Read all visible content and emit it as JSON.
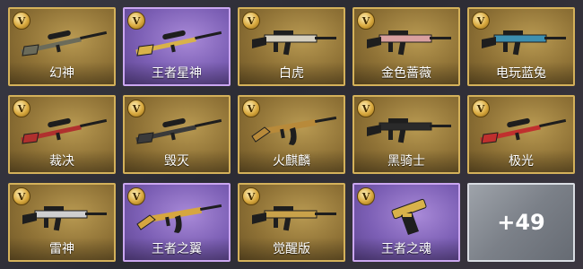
{
  "badge_letter": "V",
  "items": [
    {
      "name": "幻神",
      "tier": "gold",
      "gun": "sniper",
      "accent": "#6b6b5a"
    },
    {
      "name": "王者星神",
      "tier": "purple",
      "gun": "sniper",
      "accent": "#d8b24a"
    },
    {
      "name": "白虎",
      "tier": "gold",
      "gun": "rifle",
      "accent": "#d6d0c0"
    },
    {
      "name": "金色蔷薇",
      "tier": "gold",
      "gun": "rifle",
      "accent": "#d9a0a0"
    },
    {
      "name": "电玩蓝兔",
      "tier": "gold",
      "gun": "rifle",
      "accent": "#3d8fb0"
    },
    {
      "name": "裁决",
      "tier": "gold",
      "gun": "sniper",
      "accent": "#b0302e"
    },
    {
      "name": "毁灭",
      "tier": "gold",
      "gun": "sniper",
      "accent": "#3a3a3a"
    },
    {
      "name": "火麒麟",
      "tier": "gold",
      "gun": "ak",
      "accent": "#b88a3a"
    },
    {
      "name": "黑骑士",
      "tier": "gold",
      "gun": "rifle",
      "accent": "#2a2a2a"
    },
    {
      "name": "极光",
      "tier": "gold",
      "gun": "sniper",
      "accent": "#c0302e"
    },
    {
      "name": "雷神",
      "tier": "gold",
      "gun": "rifle",
      "accent": "#cfcfcf"
    },
    {
      "name": "王者之翼",
      "tier": "purple",
      "gun": "ak",
      "accent": "#d6a640"
    },
    {
      "name": "觉醒版",
      "tier": "gold",
      "gun": "rifle",
      "accent": "#c9a24a"
    },
    {
      "name": "王者之魂",
      "tier": "purple",
      "gun": "pistol",
      "accent": "#d8b24a"
    }
  ],
  "more": {
    "label": "+49"
  }
}
